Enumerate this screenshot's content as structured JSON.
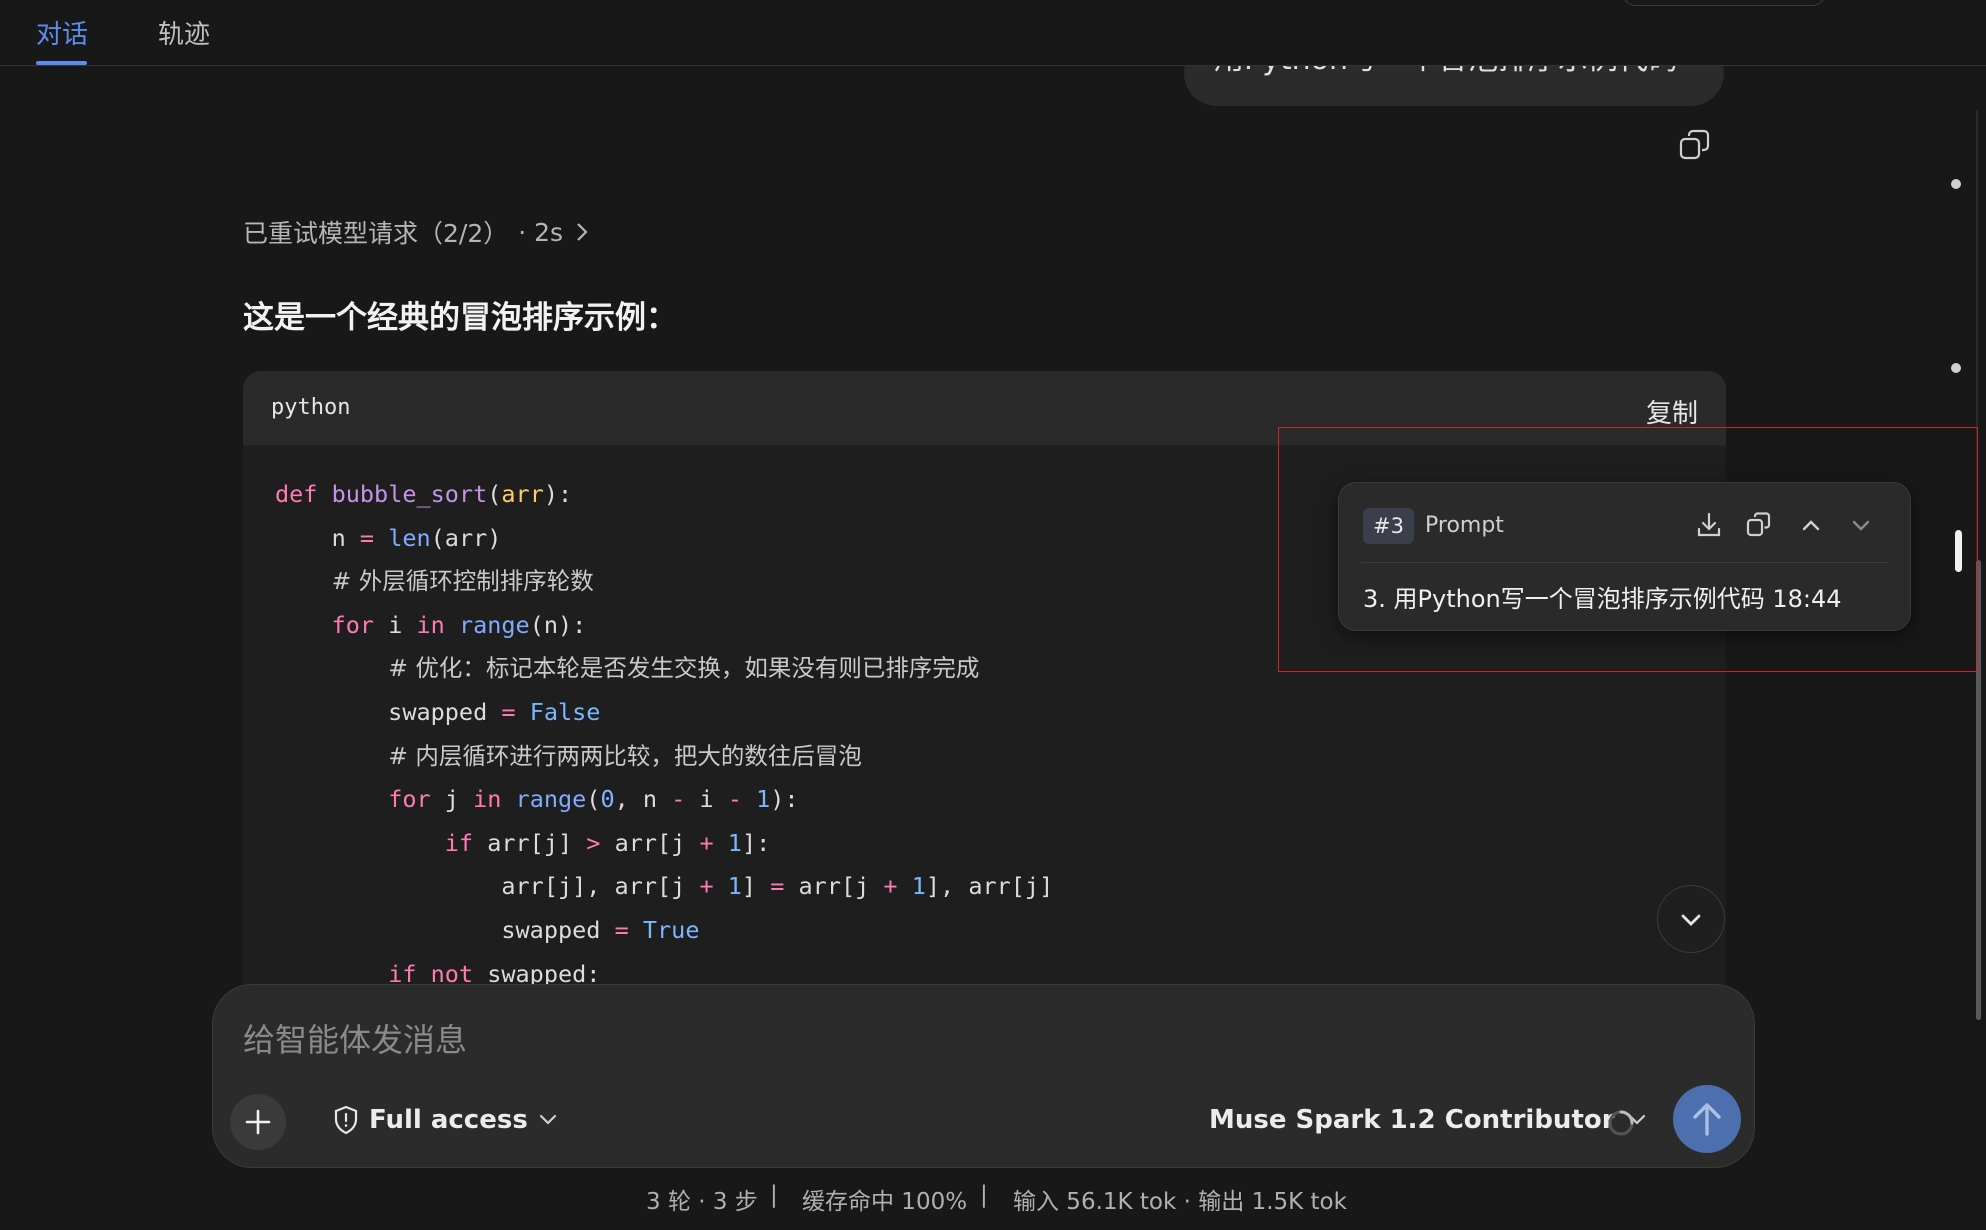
{
  "tabs": [
    {
      "label": "对话",
      "active": true
    },
    {
      "label": "轨迹",
      "active": false
    }
  ],
  "user_message": "用Python写一个冒泡排序示例代码",
  "retry": {
    "label": "已重试模型请求（2/2）",
    "duration": "· 2s"
  },
  "answer_title": "这是一个经典的冒泡排序示例：",
  "code_block": {
    "language": "python",
    "copy_label": "复制"
  },
  "code_lines": [
    "def bubble_sort(arr):",
    "    n = len(arr)",
    "    # 外层循环控制排序轮数",
    "    for i in range(n):",
    "        # 优化：标记本轮是否发生交换，如果没有则已排序完成",
    "        swapped = False",
    "        # 内层循环进行两两比较，把大的数往后冒泡",
    "        for j in range(0, n - i - 1):",
    "            if arr[j] > arr[j + 1]:",
    "                arr[j], arr[j + 1] = arr[j + 1], arr[j]",
    "                swapped = True",
    "        if not swapped:"
  ],
  "prompt_popover": {
    "badge": "#3",
    "title": "Prompt",
    "text": "3. 用Python写一个冒泡排序示例代码 18:44",
    "icons": [
      "download-icon",
      "copy-icon",
      "chevron-up-icon",
      "chevron-down-icon"
    ]
  },
  "composer": {
    "placeholder": "给智能体发消息",
    "value": "",
    "access_label": "Full access",
    "model_label": "Muse Spark 1.2 Contributor"
  },
  "footer": {
    "turns": "3 轮 · 3 步",
    "sep1": "|",
    "cache": "缓存命中 100%",
    "sep2": "|",
    "tokens": "输入 56.1K tok · 输出 1.5K tok"
  },
  "colors": {
    "accent": "#5b8def",
    "send_button": "#4c6fad",
    "highlight_border": "#c62828"
  }
}
